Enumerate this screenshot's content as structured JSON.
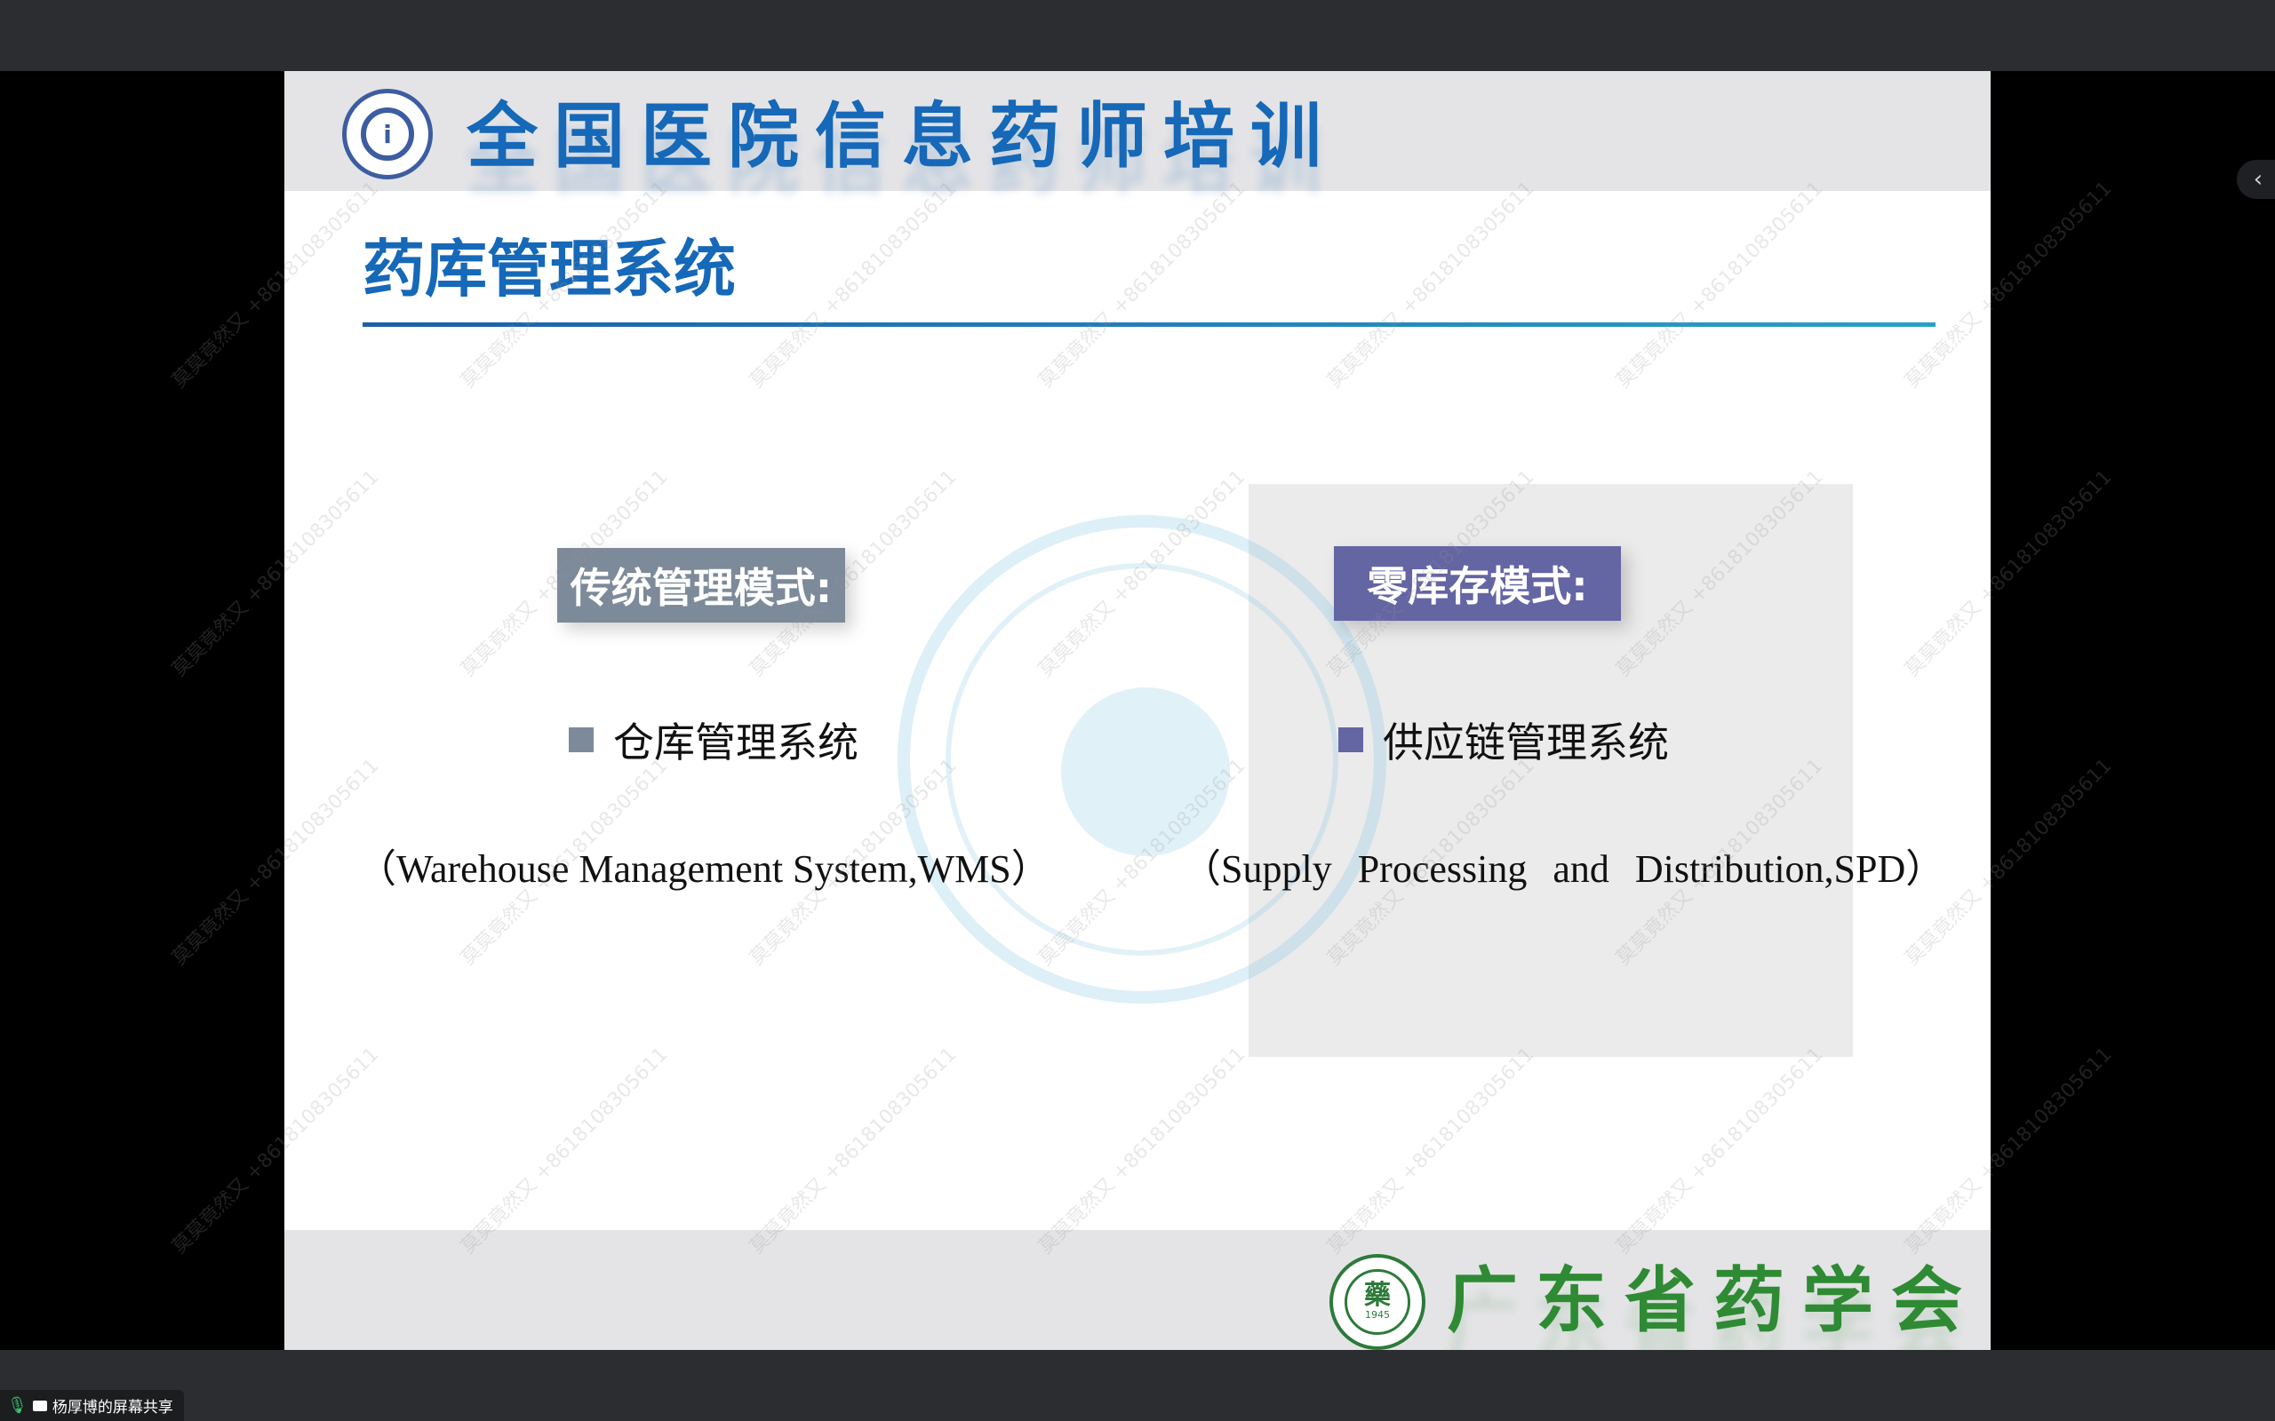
{
  "screen_share": {
    "sharer_label": "杨厚博的屏幕共享"
  },
  "slide": {
    "header_title": "全国医院信息药师培训",
    "page_title": "药库管理系统",
    "left": {
      "tag": "传统管理模式:",
      "item": "仓库管理系统",
      "item_detail": "（Warehouse Management System,WMS）"
    },
    "right": {
      "tag": "零库存模式:",
      "item": "供应链管理系统",
      "item_detail": "（Supply Processing and Distribution,SPD）"
    },
    "footer_title": "广东省药学会",
    "footer_seal_glyph": "藥",
    "footer_seal_year": "1945",
    "watermark_text": "莫莫竟然又 +8618108305611"
  },
  "icons": {
    "mic": "microphone-icon",
    "screen": "screen-share-icon",
    "collapse": "chevron-left-icon"
  },
  "colors": {
    "title_blue": "#1668b8",
    "left_accent": "#7d8a99",
    "right_accent": "#6465a3",
    "footer_green": "#2f8a34"
  }
}
